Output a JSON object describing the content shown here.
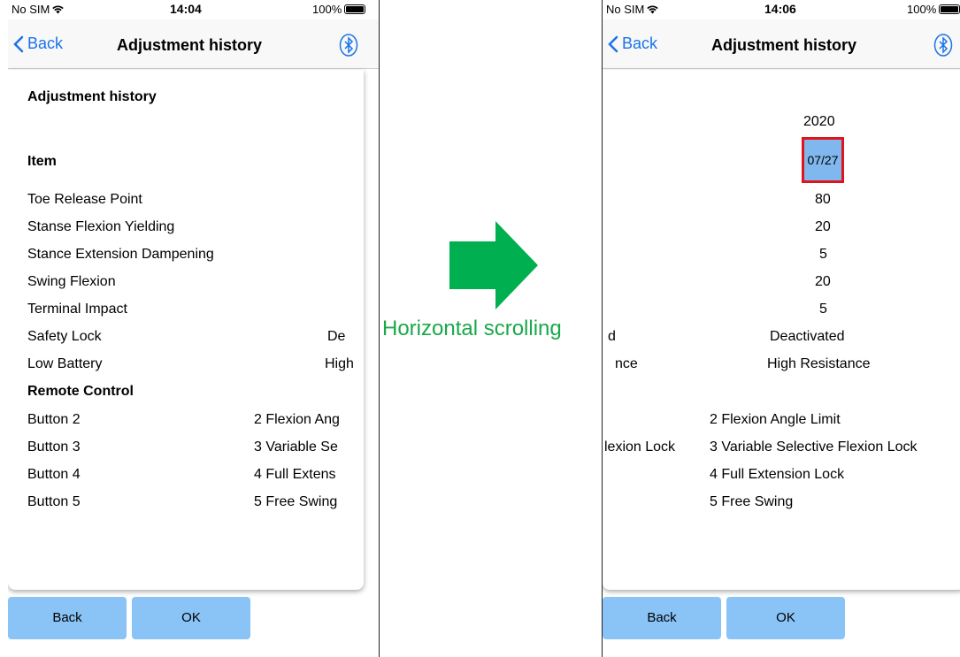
{
  "status": {
    "carrier": "No SIM",
    "time_left": "14:04",
    "time_right": "14:06",
    "battery": "100%"
  },
  "nav": {
    "back_label": "Back",
    "title": "Adjustment history"
  },
  "left": {
    "heading": "Adjustment history",
    "item_header": "Item",
    "items": [
      {
        "label": "Toe Release Point",
        "value": ""
      },
      {
        "label": "Stanse Flexion Yielding",
        "value": ""
      },
      {
        "label": "Stance Extension Dampening",
        "value": ""
      },
      {
        "label": "Swing Flexion",
        "value": ""
      },
      {
        "label": "Terminal Impact",
        "value": ""
      },
      {
        "label": "Safety Lock",
        "value": "De"
      },
      {
        "label": "Low Battery",
        "value": "High"
      }
    ],
    "remote_header": "Remote Control",
    "remote": [
      {
        "label": "Button 2",
        "value": "2 Flexion Ang"
      },
      {
        "label": "Button 3",
        "value": "3 Variable Se"
      },
      {
        "label": "Button 4",
        "value": "4 Full Extens"
      },
      {
        "label": "Button 5",
        "value": "5 Free Swing"
      }
    ]
  },
  "right": {
    "year": "2020",
    "date": "07/27",
    "values": [
      "80",
      "20",
      "5",
      "20",
      "5",
      "Deactivated",
      "High Resistance"
    ],
    "partial_labels": [
      "d",
      "nce"
    ],
    "remote_values": [
      "2 Flexion Angle Limit",
      "3 Variable Selective Flexion Lock",
      "4 Full Extension Lock",
      "5 Free Swing"
    ],
    "remote_partial": "lexion Lock"
  },
  "buttons": {
    "back": "Back",
    "ok": "OK"
  },
  "annotation": {
    "label": "Horizontal scrolling",
    "arrow_color": "#00b050"
  },
  "colors": {
    "link": "#1a73e8",
    "button": "#8ac3f5",
    "highlight_border": "#e0151b",
    "highlight_fill": "#7fb7ee"
  }
}
